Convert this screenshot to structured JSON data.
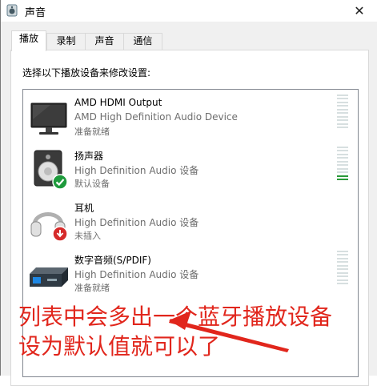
{
  "window": {
    "title": "声音",
    "close_glyph": "✕",
    "title_icon": "speaker-icon"
  },
  "tabs": [
    {
      "label": "播放",
      "active": true
    },
    {
      "label": "录制",
      "active": false
    },
    {
      "label": "声音",
      "active": false
    },
    {
      "label": "通信",
      "active": false
    }
  ],
  "panel": {
    "instruction": "选择以下播放设备来修改设置:"
  },
  "devices": [
    {
      "name": "AMD HDMI Output",
      "description": "AMD High Definition Audio Device",
      "status": "准备就绪",
      "icon": "monitor-icon",
      "badge": "none",
      "meter_level": 0
    },
    {
      "name": "扬声器",
      "description": "High Definition Audio 设备",
      "status": "默认设备",
      "icon": "speaker-icon",
      "badge": "default-check",
      "meter_level": 0.2
    },
    {
      "name": "耳机",
      "description": "High Definition Audio 设备",
      "status": "未插入",
      "icon": "headphones-icon",
      "badge": "unplugged",
      "meter_level": 0
    },
    {
      "name": "数字音频(S/PDIF)",
      "description": "High Definition Audio 设备",
      "status": "准备就绪",
      "icon": "spdif-device-icon",
      "badge": "none",
      "meter_level": 0
    }
  ],
  "annotation": {
    "line1": "列表中会多出一个蓝牙播放设备",
    "line2": "设为默认值就可以了",
    "color": "#e1261c"
  },
  "colors": {
    "accent": "#0078d7",
    "meter_on": "#2a9a39",
    "meter_off": "#d7dfe0",
    "annotation_red": "#e1261c"
  }
}
